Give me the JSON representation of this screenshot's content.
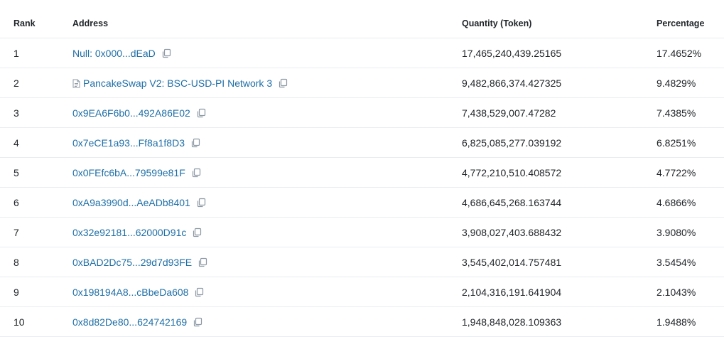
{
  "headers": {
    "rank": "Rank",
    "address": "Address",
    "quantity": "Quantity (Token)",
    "percentage": "Percentage"
  },
  "rows": [
    {
      "rank": "1",
      "address": "Null: 0x000...dEaD",
      "quantity": "17,465,240,439.25165",
      "percentage": "17.4652%",
      "contract": false
    },
    {
      "rank": "2",
      "address": "PancakeSwap V2: BSC-USD-PI Network 3",
      "quantity": "9,482,866,374.427325",
      "percentage": "9.4829%",
      "contract": true
    },
    {
      "rank": "3",
      "address": "0x9EA6F6b0...492A86E02",
      "quantity": "7,438,529,007.47282",
      "percentage": "7.4385%",
      "contract": false
    },
    {
      "rank": "4",
      "address": "0x7eCE1a93...Ff8a1f8D3",
      "quantity": "6,825,085,277.039192",
      "percentage": "6.8251%",
      "contract": false
    },
    {
      "rank": "5",
      "address": "0x0FEfc6bA...79599e81F",
      "quantity": "4,772,210,510.408572",
      "percentage": "4.7722%",
      "contract": false
    },
    {
      "rank": "6",
      "address": "0xA9a3990d...AeADb8401",
      "quantity": "4,686,645,268.163744",
      "percentage": "4.6866%",
      "contract": false
    },
    {
      "rank": "7",
      "address": "0x32e92181...62000D91c",
      "quantity": "3,908,027,403.688432",
      "percentage": "3.9080%",
      "contract": false
    },
    {
      "rank": "8",
      "address": "0xBAD2Dc75...29d7d93FE",
      "quantity": "3,545,402,014.757481",
      "percentage": "3.5454%",
      "contract": false
    },
    {
      "rank": "9",
      "address": "0x198194A8...cBbeDa608",
      "quantity": "2,104,316,191.641904",
      "percentage": "2.1043%",
      "contract": false
    },
    {
      "rank": "10",
      "address": "0x8d82De80...624742169",
      "quantity": "1,948,848,028.109363",
      "percentage": "1.9488%",
      "contract": false
    }
  ],
  "colors": {
    "link": "#1e6ea6",
    "icon": "#8c98a4",
    "border": "#e9ecef"
  },
  "icons": {
    "copy": "copy-icon",
    "contract": "document-icon"
  }
}
